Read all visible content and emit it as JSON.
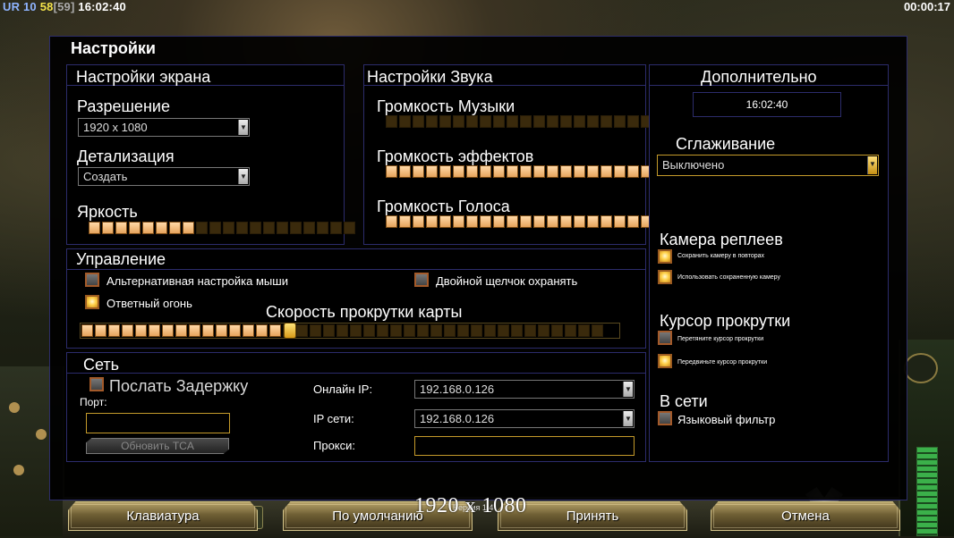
{
  "hud": {
    "faction": "UR",
    "num": "10",
    "fps": "58",
    "fps_cap": "[59]",
    "clock": "16:02:40",
    "game_time": "00:00:17"
  },
  "window": {
    "title": "Настройки"
  },
  "screen": {
    "title": "Настройки экрана",
    "resolution_label": "Разрешение",
    "resolution_value": "1920 x 1080",
    "detail_label": "Детализация",
    "detail_value": "Создать",
    "brightness_label": "Яркость",
    "brightness_level": 8,
    "brightness_segments": 20
  },
  "sound": {
    "title": "Настройки Звука",
    "music_label": "Громкость Музыки",
    "music_level": 0,
    "effects_label": "Громкость эффектов",
    "effects_level": 20,
    "voice_label": "Громкость Голоса",
    "voice_level": 20,
    "segments": 20
  },
  "extra": {
    "title": "Дополнительно",
    "clock": "16:02:40",
    "aa_label": "Сглаживание",
    "aa_value": "Выключено",
    "replay_camera_label": "Камера реплеев",
    "replay_opt1": "Сохранить камеру в повторах",
    "replay_opt2": "Использовать сохраненную камеру",
    "scroll_cursor_label": "Курсор прокрутки",
    "scroll_opt1": "Перетяните курсор прокрутки",
    "scroll_opt2": "Передвиньте курсор прокрутки",
    "online_label": "В сети",
    "lang_filter": "Языковый фильтр"
  },
  "control": {
    "title": "Управление",
    "alt_mouse": "Альтернативная настройка мыши",
    "double_click": "Двойной щелчок охранять",
    "return_fire": "Ответный огонь",
    "scroll_speed_label": "Скорость прокрутки карты",
    "scroll_speed_level": 15,
    "scroll_speed_segments": 39
  },
  "network": {
    "title": "Сеть",
    "send_delay": "Послать Задержку",
    "port_label": "Порт:",
    "port_value": "",
    "update_tca": "Обновить TCA",
    "online_ip_label": "Онлайн IP:",
    "online_ip_value": "192.168.0.126",
    "lan_ip_label": "IP сети:",
    "lan_ip_value": "192.168.0.126",
    "proxy_label": "Прокси:",
    "proxy_value": ""
  },
  "buttons": {
    "keyboard": "Клавиатура",
    "defaults": "По умолчанию",
    "accept": "Принять",
    "cancel": "Отмена"
  },
  "overlay": {
    "resolution": "1920 x 1080",
    "version": "Версия 1.4"
  },
  "colors": {
    "panel_border": "#2c2c6c",
    "accent_gold": "#c49a2a",
    "slider_on": "#f1bb7c",
    "slider_off": "#3a2a0c"
  }
}
